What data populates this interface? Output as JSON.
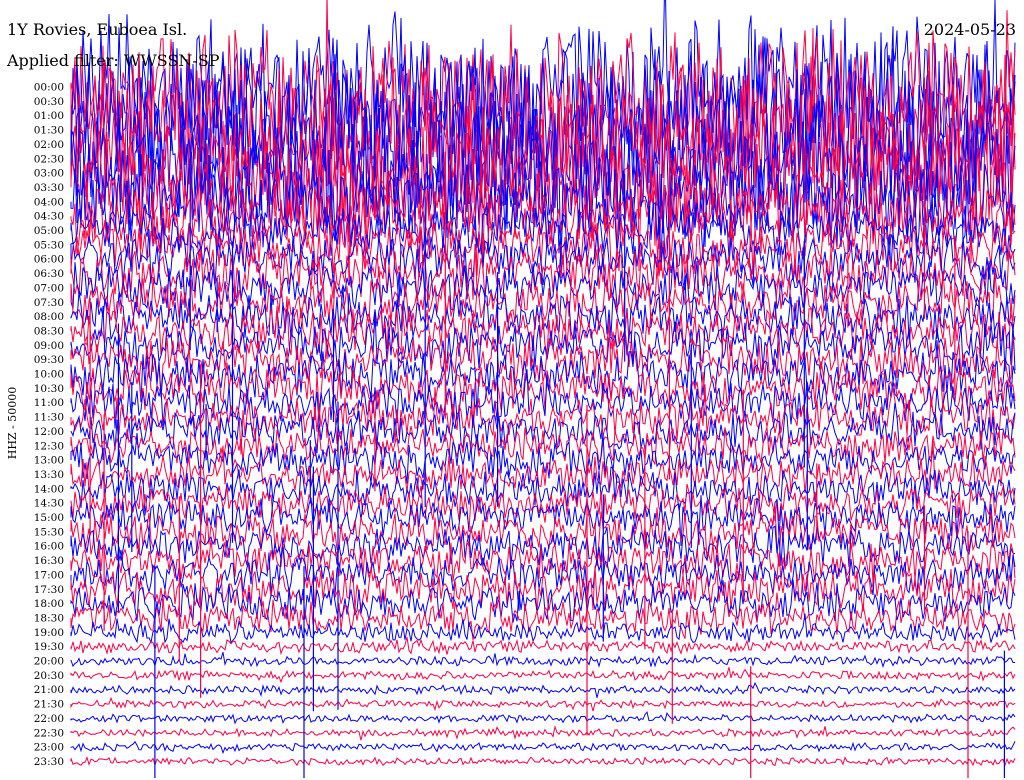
{
  "chart_data": {
    "type": "line",
    "title": "1Y Rovies, Euboea Isl.",
    "date": "2024-05-23",
    "filter_label": "Applied filter: WWSSN-SP",
    "ylabel": "HHZ - 50000",
    "row_labels": [
      "00:00",
      "00:30",
      "01:00",
      "01:30",
      "02:00",
      "02:30",
      "03:00",
      "03:30",
      "04:00",
      "04:30",
      "05:00",
      "05:30",
      "06:00",
      "06:30",
      "07:00",
      "07:30",
      "08:00",
      "08:30",
      "09:00",
      "09:30",
      "10:00",
      "10:30",
      "11:00",
      "11:30",
      "12:00",
      "12:30",
      "13:00",
      "13:30",
      "14:00",
      "14:30",
      "15:00",
      "15:30",
      "16:00",
      "16:30",
      "17:00",
      "17:30",
      "18:00",
      "18:30",
      "19:00",
      "19:30",
      "20:00",
      "20:30",
      "21:00",
      "21:30",
      "22:00",
      "22:30",
      "23:00",
      "23:30"
    ],
    "trace_colors": [
      "#0000ff",
      "#ff0044"
    ],
    "amplitude_profile": [
      5.5,
      5.5,
      5.5,
      5.5,
      5.5,
      5.5,
      5.2,
      4.6,
      3.5,
      2.6,
      2.1,
      2.0,
      2.0,
      1.9,
      1.9,
      1.8,
      1.8,
      1.8,
      1.8,
      1.8,
      1.7,
      1.7,
      1.6,
      1.5,
      1.5,
      1.4,
      1.4,
      1.4,
      1.4,
      1.4,
      1.4,
      1.5,
      1.5,
      1.5,
      1.5,
      1.5,
      1.5,
      1.3,
      0.8,
      0.5,
      0.4,
      0.35,
      0.33,
      0.3,
      0.3,
      0.3,
      0.3,
      0.3
    ]
  }
}
